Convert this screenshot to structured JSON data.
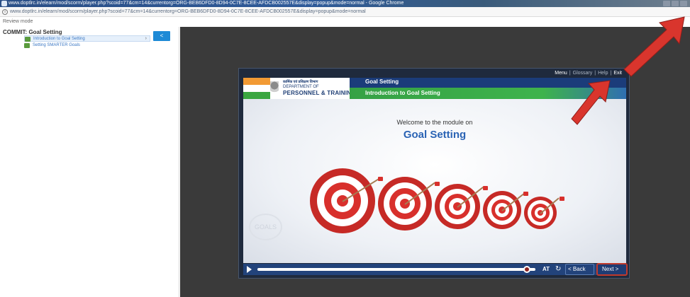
{
  "window": {
    "title": "www.doptlrc.in/elearn/mod/scorm/player.php?scoid=77&cm=14&currentorg=ORG-BEB6DFD0-8D94-0C7E-8CEE-AFDCB002557E&display=popup&mode=normal - Google Chrome",
    "url": "www.doptlrc.in/elearn/mod/scorm/player.php?scoid=77&cm=14&currentorg=ORG-BEB6DFD0-8D94-0C7E-8CEE-AFDCB002557E&display=popup&mode=normal"
  },
  "sidebar": {
    "review_mode": "Review mode",
    "course_title": "COMMIT: Goal Setting",
    "items": [
      {
        "label": "Introduction to Goal Setting"
      },
      {
        "label": "Setting SMARTER Goals"
      }
    ],
    "collapse_label": "<",
    "item_arrow": "›"
  },
  "slide": {
    "nav": {
      "menu": "Menu",
      "glossary": "Glossary",
      "help": "Help",
      "exit": "Exit",
      "sep": "|"
    },
    "dept_hindi": "कार्मिक एवं प्रशिक्षण विभाग",
    "dept_of": "DEPARTMENT OF",
    "dept_name": "PERSONNEL & TRAINING",
    "title": "Goal Setting",
    "subtitle": "Introduction to Goal Setting",
    "welcome": "Welcome to the module on",
    "module_title": "Goal Setting",
    "watermark": "GOALS"
  },
  "controls": {
    "progress": 0.97,
    "at_label": "AT",
    "replay_symbol": "↻",
    "back_label": "< Back",
    "next_label": "Next >"
  },
  "colors": {
    "accent_blue": "#1b3c7a",
    "green": "#3eb34c",
    "target_red": "#d8302c",
    "arrow_red": "#d9352d"
  }
}
